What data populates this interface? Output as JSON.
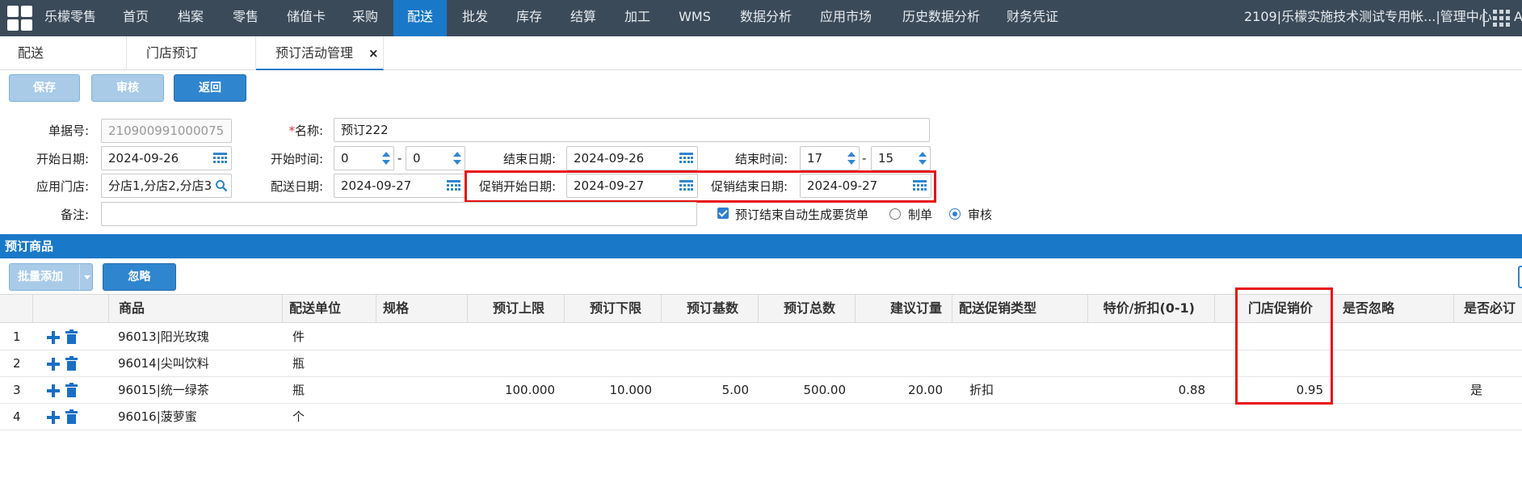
{
  "nav": {
    "brand": "乐檬零售",
    "items": [
      "首页",
      "档案",
      "零售",
      "储值卡",
      "采购",
      "配送",
      "批发",
      "库存",
      "结算",
      "加工",
      "WMS",
      "数据分析",
      "应用市场",
      "历史数据分析",
      "财务凭证"
    ],
    "active_index": 5,
    "org_info": "2109|乐檬实施技术测试专用帐...|管理中心",
    "overflow_letter": "A"
  },
  "tabs": [
    "配送",
    "门店预订",
    "预订活动管理"
  ],
  "toolbar": {
    "save": "保存",
    "review": "审核",
    "back": "返回"
  },
  "form": {
    "doc_no_label": "单据号:",
    "doc_no": "210900991000075",
    "name_required": "*",
    "name_label": "名称:",
    "name": "预订222",
    "start_date_label": "开始日期:",
    "start_date": "2024-09-26",
    "start_time_label": "开始时间:",
    "start_hour": "0",
    "start_minute": "0",
    "end_date_label": "结束日期:",
    "end_date": "2024-09-26",
    "end_time_label": "结束时间:",
    "end_hour": "17",
    "end_minute": "15",
    "stores_label": "应用门店:",
    "stores": "分店1,分店2,分店3",
    "delivery_date_label": "配送日期:",
    "delivery_date": "2024-09-27",
    "promo_start_label": "促销开始日期:",
    "promo_start": "2024-09-27",
    "promo_end_label": "促销结束日期:",
    "promo_end": "2024-09-27",
    "remark_label": "备注:",
    "remark": "",
    "auto_order_label": "预订结束自动生成要货单",
    "auto_order_checked": true,
    "mode_draft": "制单",
    "mode_review": "审核",
    "mode_selected": "审核"
  },
  "section_title": "预订商品",
  "grid_toolbar": {
    "batch_add": "批量添加",
    "ignore": "忽略"
  },
  "columns": [
    "商品",
    "配送单位",
    "规格",
    "预订上限",
    "预订下限",
    "预订基数",
    "预订总数",
    "建议订量",
    "配送促销类型",
    "特价/折扣(0-1)",
    "门店促销价",
    "是否忽略",
    "是否必订"
  ],
  "rows": [
    {
      "no": "1",
      "product": "96013|阳光玫瑰",
      "unit": "件",
      "spec": "",
      "max": "",
      "min": "",
      "base": "",
      "total": "",
      "suggest": "",
      "promo_type": "",
      "special": "",
      "store_price": "",
      "ignore": "",
      "required": ""
    },
    {
      "no": "2",
      "product": "96014|尖叫饮料",
      "unit": "瓶",
      "spec": "",
      "max": "",
      "min": "",
      "base": "",
      "total": "",
      "suggest": "",
      "promo_type": "",
      "special": "",
      "store_price": "",
      "ignore": "",
      "required": ""
    },
    {
      "no": "3",
      "product": "96015|统一绿茶",
      "unit": "瓶",
      "spec": "",
      "max": "100.000",
      "min": "10.000",
      "base": "5.00",
      "total": "500.00",
      "suggest": "20.00",
      "promo_type": "折扣",
      "special": "0.88",
      "store_price": "0.95",
      "ignore": "",
      "required": "是"
    },
    {
      "no": "4",
      "product": "96016|菠萝蜜",
      "unit": "个",
      "spec": "",
      "max": "",
      "min": "",
      "base": "",
      "total": "",
      "suggest": "",
      "promo_type": "",
      "special": "",
      "store_price": "",
      "ignore": "",
      "required": ""
    }
  ],
  "colors": {
    "nav_bg": "#3b4a59",
    "accent": "#1a78c8",
    "highlight": "#e81212"
  }
}
